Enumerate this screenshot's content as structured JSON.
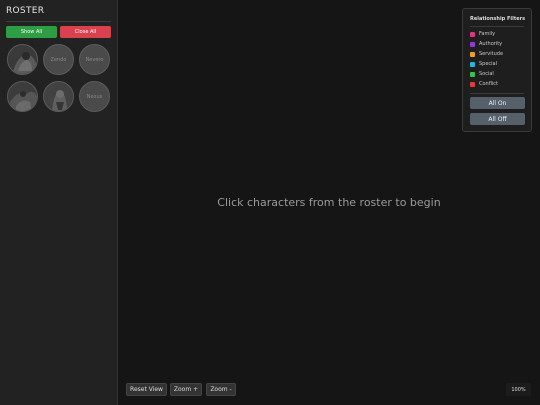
{
  "sidebar": {
    "title": "ROSTER",
    "show_all": "Show All",
    "close_all": "Close All",
    "characters": [
      {
        "label": "",
        "has_image": true
      },
      {
        "label": "Zendo",
        "has_image": false
      },
      {
        "label": "Nevero",
        "has_image": false
      },
      {
        "label": "",
        "has_image": true
      },
      {
        "label": "",
        "has_image": true
      },
      {
        "label": "Nexus",
        "has_image": false
      }
    ]
  },
  "filters": {
    "title": "Relationship Filters",
    "items": [
      {
        "label": "Family",
        "color": "#e0357f"
      },
      {
        "label": "Authority",
        "color": "#8e3bd8"
      },
      {
        "label": "Servitude",
        "color": "#e8a12c"
      },
      {
        "label": "Special",
        "color": "#22b8d8"
      },
      {
        "label": "Social",
        "color": "#3bc24a"
      },
      {
        "label": "Conflict",
        "color": "#e43c3c"
      }
    ],
    "all_on": "All On",
    "all_off": "All Off"
  },
  "canvas": {
    "hint": "Click characters from the roster to begin"
  },
  "controls": {
    "reset_view": "Reset View",
    "zoom_in": "Zoom +",
    "zoom_out": "Zoom -",
    "zoom_level": "100%"
  }
}
